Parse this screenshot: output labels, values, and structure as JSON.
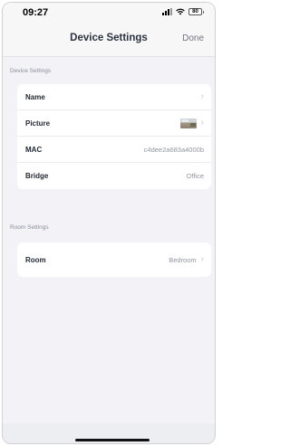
{
  "status_bar": {
    "time": "09:27",
    "battery": "80",
    "signal_icon": "signal-bars-icon",
    "wifi_icon": "wifi-icon"
  },
  "nav": {
    "title": "Device Settings",
    "done_label": "Done"
  },
  "device_section": {
    "header": "Device Settings",
    "rows": [
      {
        "label": "Name",
        "value": "",
        "chevron": "›"
      },
      {
        "label": "Picture",
        "value": "",
        "chevron": "›"
      },
      {
        "label": "MAC",
        "value": "c4dee2a683a4000b"
      },
      {
        "label": "Bridge",
        "value": "Office"
      }
    ]
  },
  "room_section": {
    "header": "Room Settings",
    "rows": [
      {
        "label": "Room",
        "value": "Bedroom",
        "chevron": "›"
      }
    ]
  }
}
